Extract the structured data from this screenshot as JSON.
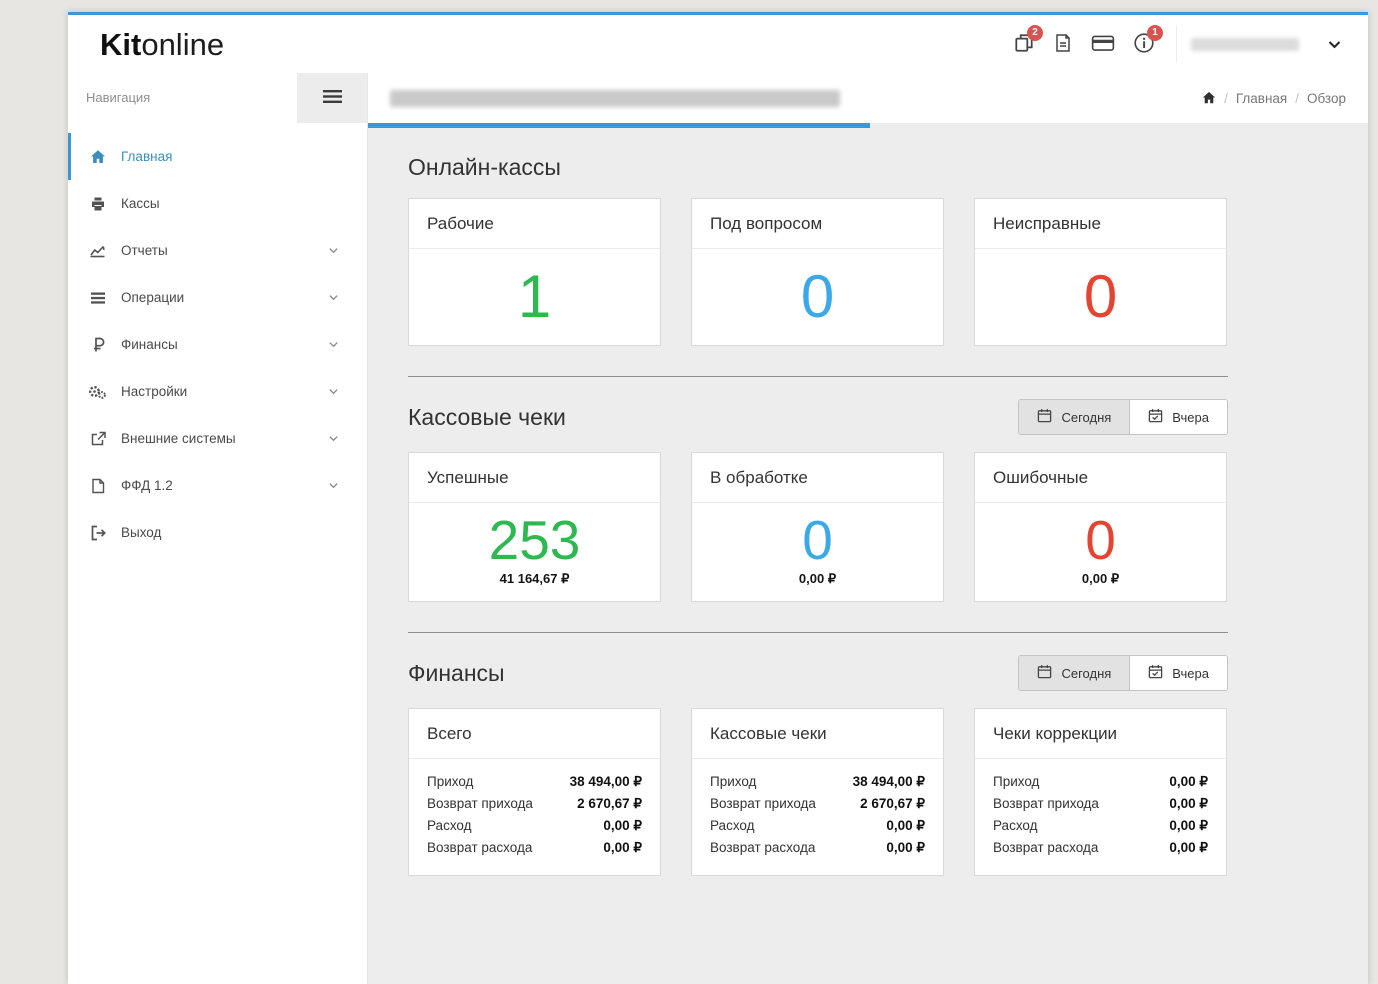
{
  "header": {
    "logo_bold": "Kit",
    "logo_light": "online",
    "badge_documents": "2",
    "badge_info": "1"
  },
  "sidebar": {
    "title": "Навигация",
    "items": [
      {
        "label": "Главная",
        "active": true
      },
      {
        "label": "Кассы"
      },
      {
        "label": "Отчеты",
        "expandable": true
      },
      {
        "label": "Операции",
        "expandable": true
      },
      {
        "label": "Финансы",
        "expandable": true
      },
      {
        "label": "Настройки",
        "expandable": true
      },
      {
        "label": "Внешние системы",
        "expandable": true
      },
      {
        "label": "ФФД 1.2",
        "expandable": true
      },
      {
        "label": "Выход"
      }
    ]
  },
  "breadcrumb": {
    "items": [
      "Главная",
      "Обзор"
    ]
  },
  "sections": {
    "online": {
      "title": "Онлайн-кассы",
      "cards": [
        {
          "label": "Рабочие",
          "value": "1",
          "color": "#2eb850"
        },
        {
          "label": "Под вопросом",
          "value": "0",
          "color": "#3ba9e8"
        },
        {
          "label": "Неисправные",
          "value": "0",
          "color": "#e54530"
        }
      ]
    },
    "receipts": {
      "title": "Кассовые чеки",
      "period_buttons": [
        {
          "label": "Сегодня",
          "active": true
        },
        {
          "label": "Вчера",
          "active": false
        }
      ],
      "cards": [
        {
          "label": "Успешные",
          "value": "253",
          "amount": "41 164,67 ₽",
          "color": "#2eb850"
        },
        {
          "label": "В обработке",
          "value": "0",
          "amount": "0,00 ₽",
          "color": "#3ba9e8"
        },
        {
          "label": "Ошибочные",
          "value": "0",
          "amount": "0,00 ₽",
          "color": "#e54530"
        }
      ]
    },
    "finances": {
      "title": "Финансы",
      "period_buttons": [
        {
          "label": "Сегодня",
          "active": true
        },
        {
          "label": "Вчера",
          "active": false
        }
      ],
      "cards": [
        {
          "label": "Всего",
          "rows": [
            {
              "label": "Приход",
              "value": "38 494,00 ₽"
            },
            {
              "label": "Возврат прихода",
              "value": "2 670,67 ₽"
            },
            {
              "label": "Расход",
              "value": "0,00 ₽"
            },
            {
              "label": "Возврат расхода",
              "value": "0,00 ₽"
            }
          ]
        },
        {
          "label": "Кассовые чеки",
          "rows": [
            {
              "label": "Приход",
              "value": "38 494,00 ₽"
            },
            {
              "label": "Возврат прихода",
              "value": "2 670,67 ₽"
            },
            {
              "label": "Расход",
              "value": "0,00 ₽"
            },
            {
              "label": "Возврат расхода",
              "value": "0,00 ₽"
            }
          ]
        },
        {
          "label": "Чеки коррекции",
          "rows": [
            {
              "label": "Приход",
              "value": "0,00 ₽"
            },
            {
              "label": "Возврат прихода",
              "value": "0,00 ₽"
            },
            {
              "label": "Расход",
              "value": "0,00 ₽"
            },
            {
              "label": "Возврат расхода",
              "value": "0,00 ₽"
            }
          ]
        }
      ]
    }
  },
  "colors": {
    "accent": "#3c97d9",
    "menu_active": "#3c8dbc",
    "green": "#2eb850",
    "blue": "#3ba9e8",
    "red": "#e54530",
    "badge": "#d9534f"
  }
}
